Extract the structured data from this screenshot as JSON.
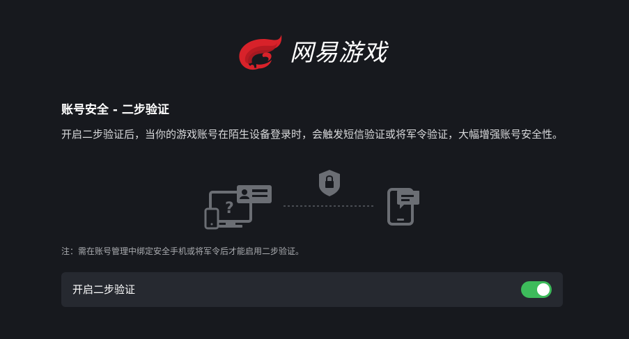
{
  "logo": {
    "text": "网易游戏"
  },
  "section": {
    "title": "账号安全 - 二步验证",
    "description": "开启二步验证后，当你的游戏账号在陌生设备登录时，会触发短信验证或将军令验证，大幅增强账号安全性。"
  },
  "illustration": {
    "unknown_mark": "?",
    "icons": [
      "desktop-unknown-device-icon",
      "shield-lock-icon",
      "phone-message-icon"
    ]
  },
  "note": "注：需在账号管理中绑定安全手机或将军令后才能启用二步验证。",
  "setting": {
    "label": "开启二步验证",
    "enabled": true
  },
  "colors": {
    "background": "#17191e",
    "card": "#262930",
    "switch_on": "#3dbb5b",
    "logo_red": "#d8222a"
  }
}
